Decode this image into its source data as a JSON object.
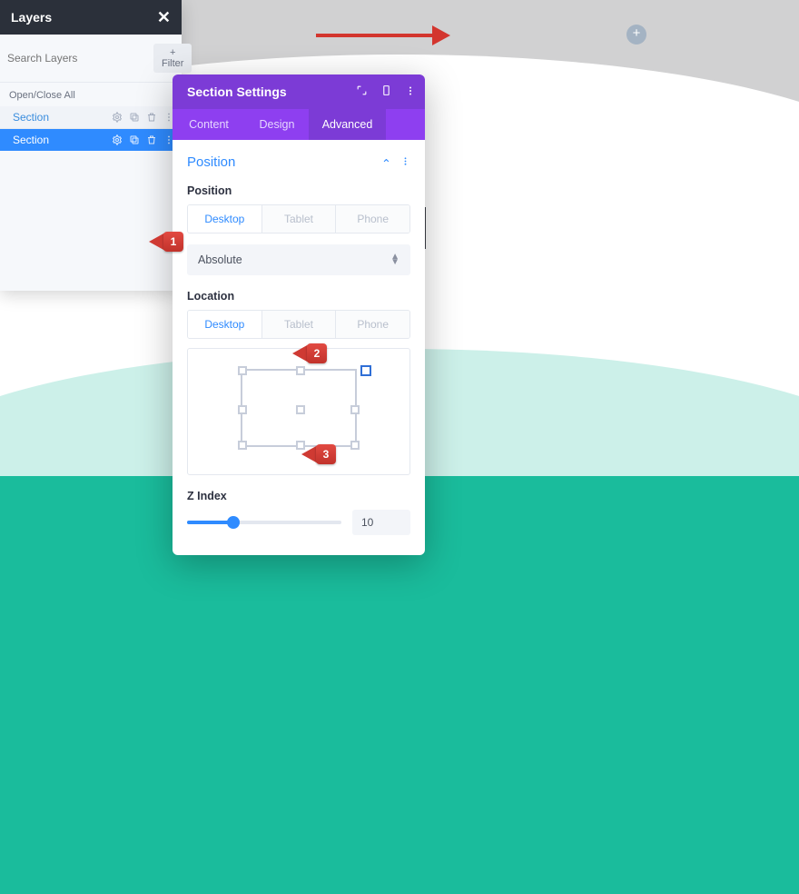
{
  "layers_panel": {
    "title": "Layers",
    "search_placeholder": "Search Layers",
    "filter_label": "+ Filter",
    "open_close_label": "Open/Close All",
    "items": [
      {
        "label": "Section",
        "active": false
      },
      {
        "label": "Section",
        "active": true
      }
    ]
  },
  "settings_panel": {
    "title": "Section Settings",
    "tabs": {
      "content": "Content",
      "design": "Design",
      "advanced": "Advanced"
    },
    "accordion_title": "Position",
    "position_label": "Position",
    "devices": {
      "desktop": "Desktop",
      "tablet": "Tablet",
      "phone": "Phone"
    },
    "position_value": "Absolute",
    "location_label": "Location",
    "zindex_label": "Z Index",
    "zindex_value": "10"
  },
  "annotations": {
    "step1": "1",
    "step2": "2",
    "step3": "3"
  },
  "icons": {
    "gear": "gear-icon",
    "duplicate": "duplicate-icon",
    "trash": "trash-icon",
    "more": "more-icon",
    "expand": "expand-icon",
    "device": "device-icon"
  }
}
